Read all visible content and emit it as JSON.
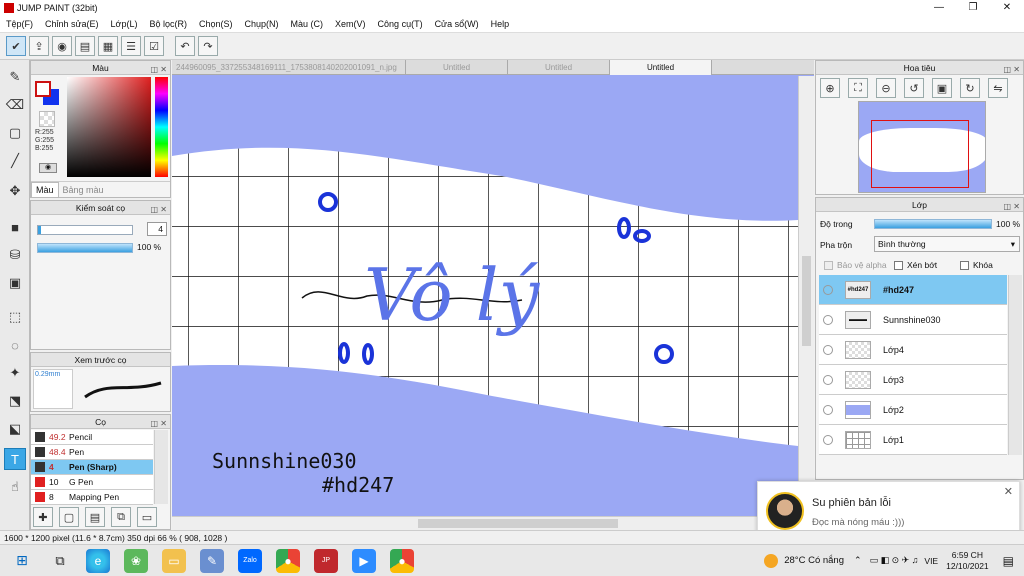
{
  "app": {
    "title": "JUMP PAINT (32bit)"
  },
  "window_buttons": [
    "—",
    "❐",
    "✕"
  ],
  "menu": [
    "Tệp(F)",
    "Chỉnh sửa(E)",
    "Lớp(L)",
    "Bộ lọc(R)",
    "Chọn(S)",
    "Chụp(N)",
    "Màu (C)",
    "Xem(V)",
    "Công cụ(T)",
    "Cửa sổ(W)",
    "Help"
  ],
  "color_panel": {
    "title": "Màu",
    "rgb": [
      "R:255",
      "G:255",
      "B:255"
    ],
    "tabs": [
      "Màu",
      "Bảng màu"
    ],
    "colors": {
      "fg": "#cc1111",
      "bg": "#1133ee"
    }
  },
  "brush_control": {
    "title": "Kiểm soát cọ",
    "size": "4",
    "opacity": "100 %"
  },
  "brush_preview": {
    "title": "Xem trước cọ",
    "size": "0.29mm"
  },
  "brushes": {
    "title": "Cọ",
    "items": [
      {
        "size": "49.2",
        "name": "Pencil",
        "color": "#333333"
      },
      {
        "size": "48.4",
        "name": "Pen",
        "color": "#333333"
      },
      {
        "size": "4",
        "name": "Pen (Sharp)",
        "color": "#333333",
        "selected": true
      },
      {
        "size": "10",
        "name": "G Pen",
        "color": "#e02020"
      },
      {
        "size": "8",
        "name": "Mapping Pen",
        "color": "#e02020"
      }
    ]
  },
  "doc_tabs": [
    "244960095_337255348169111_1753808140202001091_n.jpg",
    "Untitled",
    "Untitled",
    "Untitled"
  ],
  "artwork": {
    "title": "Vô lý",
    "credit1": "Sunnshine030",
    "credit2": "#hd247"
  },
  "navigator": {
    "title": "Hoa tiêu"
  },
  "layers": {
    "title": "Lớp",
    "opacity_label": "Độ trong",
    "opacity_value": "100 %",
    "blend_label": "Pha trộn",
    "blend_value": "Bình thường",
    "options": [
      "Bảo vệ alpha",
      "Xén bớt",
      "Khóa"
    ],
    "items": [
      {
        "name": "#hd247",
        "thumb": "#hd247",
        "selected": true
      },
      {
        "name": "Sunnshine030",
        "thumb": "▬▬▬"
      },
      {
        "name": "Lớp4",
        "thumb": ""
      },
      {
        "name": "Lớp3",
        "thumb": ""
      },
      {
        "name": "Lớp2",
        "thumb": ""
      },
      {
        "name": "Lớp1",
        "thumb": ""
      }
    ]
  },
  "status": {
    "text": "1600 * 1200 pixel   (11.6 * 8.7cm)   350 dpi   66 %   ( 908, 1028 )"
  },
  "notification": {
    "title": "Su phiên bản lỗi",
    "body": "Đọc mà nóng máu :)))"
  },
  "taskbar": {
    "weather": "28°C  Có nắng",
    "lang": "VIE",
    "time": "6:59 CH",
    "date": "12/10/2021"
  }
}
